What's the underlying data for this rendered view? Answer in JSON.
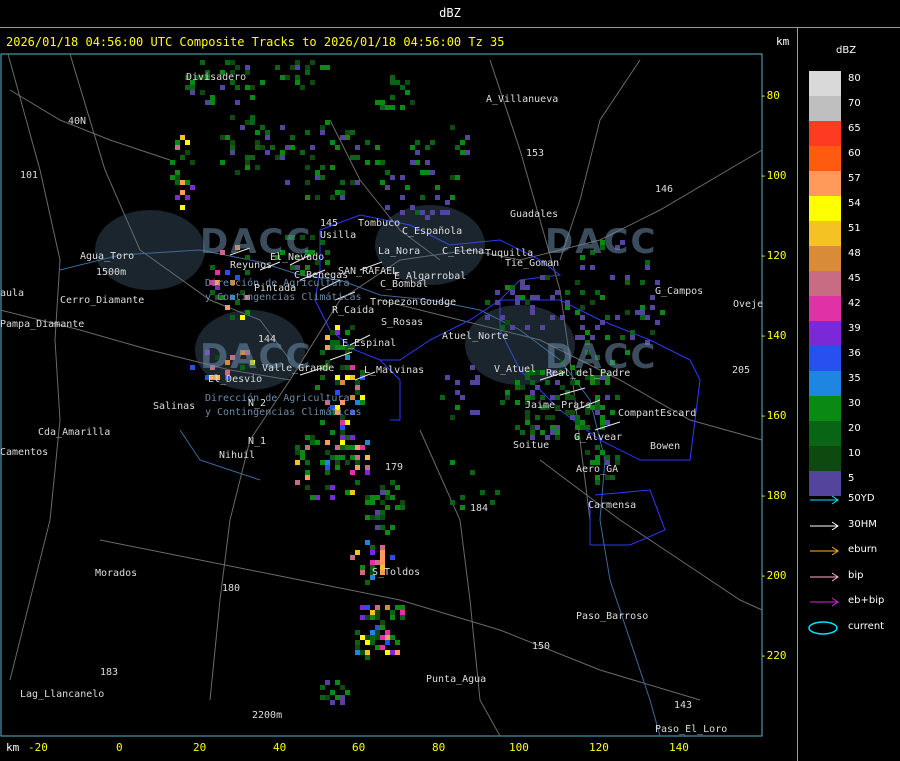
{
  "window_title": "dBZ",
  "header": {
    "text": "2026/01/18 04:56:00 UTC Composite Tracks to 2026/01/18 04:56:00 Tz 35",
    "km_label": "km"
  },
  "legend": {
    "title": "dBZ",
    "entries": [
      {
        "label": "80",
        "color": "#d9d9d9"
      },
      {
        "label": "70",
        "color": "#bfbfbf"
      },
      {
        "label": "65",
        "color": "#ff3a22"
      },
      {
        "label": "60",
        "color": "#ff5a10"
      },
      {
        "label": "57",
        "color": "#ff9a5a"
      },
      {
        "label": "54",
        "color": "#ffff00"
      },
      {
        "label": "51",
        "color": "#f5c224"
      },
      {
        "label": "48",
        "color": "#d88c38"
      },
      {
        "label": "45",
        "color": "#c86c84"
      },
      {
        "label": "42",
        "color": "#e032a6"
      },
      {
        "label": "39",
        "color": "#7b28d8"
      },
      {
        "label": "36",
        "color": "#2850f0"
      },
      {
        "label": "35",
        "color": "#1e86e0"
      },
      {
        "label": "30",
        "color": "#0a8a14"
      },
      {
        "label": "20",
        "color": "#0a6416"
      },
      {
        "label": "10",
        "color": "#0e4a10"
      },
      {
        "label": "5",
        "color": "#54449c"
      }
    ]
  },
  "tracks": [
    {
      "label": "50YD",
      "color": "#00e5ff",
      "icon": "arrow-icon"
    },
    {
      "label": "30HM",
      "color": "#ffffff",
      "icon": "arrow-icon"
    },
    {
      "label": "eburn",
      "color": "#ffb030",
      "icon": "arrow-icon"
    },
    {
      "label": "bip",
      "color": "#ffb0d8",
      "icon": "arrow-icon"
    },
    {
      "label": "eb+bip",
      "color": "#e020e0",
      "icon": "arrow-icon"
    },
    {
      "label": "current",
      "color": "#00e5ff",
      "icon": "ellipse-icon"
    }
  ],
  "y_axis": {
    "labels": [
      "-80",
      "-100",
      "-120",
      "-140",
      "-160",
      "-180",
      "-200",
      "-220"
    ]
  },
  "x_axis": {
    "unit": "km",
    "labels": [
      "-20",
      "0",
      "20",
      "40",
      "60",
      "80",
      "100",
      "120",
      "140"
    ]
  },
  "places": [
    "Divisadero",
    "A_Villanueva",
    "Tombuco",
    "Usilla",
    "C_Española",
    "La_Nora",
    "C_Elena",
    "Tuquilla",
    "Tie_Goman",
    "Guadales",
    "Agua_Toro",
    "1500m",
    "Pampa_Diamante",
    "Cerro_Diamante",
    "Reyunos",
    "Pintada",
    "El_Nevado",
    "C_Benegas",
    "SAN_RAFAEL",
    "E_Algarrobal",
    "C_Bombal",
    "Tropezon",
    "Goudge",
    "R_Caida",
    "S_Rosas",
    "Atuel_Norte",
    "E_Espinal",
    "L_Malvinas",
    "El_Desvio",
    "Valle_Grande",
    "Salinas",
    "N_2",
    "N_1",
    "Nihuil",
    "Cda_Amarilla",
    "V_Atuel",
    "Real_del_Padre",
    "Jaime_Prats",
    "CompantEscard",
    "G_Alvear",
    "Soitue",
    "Bowen",
    "Aero_GA",
    "Carmensa",
    "S_Toldos",
    "Morados",
    "Paso_Barroso",
    "Punta_Agua",
    "Lag_Llancanelo",
    "2200m",
    "Paso_El_Loro",
    "Oveje",
    "G_Campos",
    "40N",
    "101",
    "153",
    "146",
    "144",
    "145",
    "179",
    "184",
    "180",
    "183",
    "150",
    "143",
    "205",
    "Camentos",
    "aula"
  ],
  "watermark": {
    "brand": "DACC",
    "line1": "Dirección de Agricultura",
    "line2": "y Contingencias Climáticas"
  }
}
